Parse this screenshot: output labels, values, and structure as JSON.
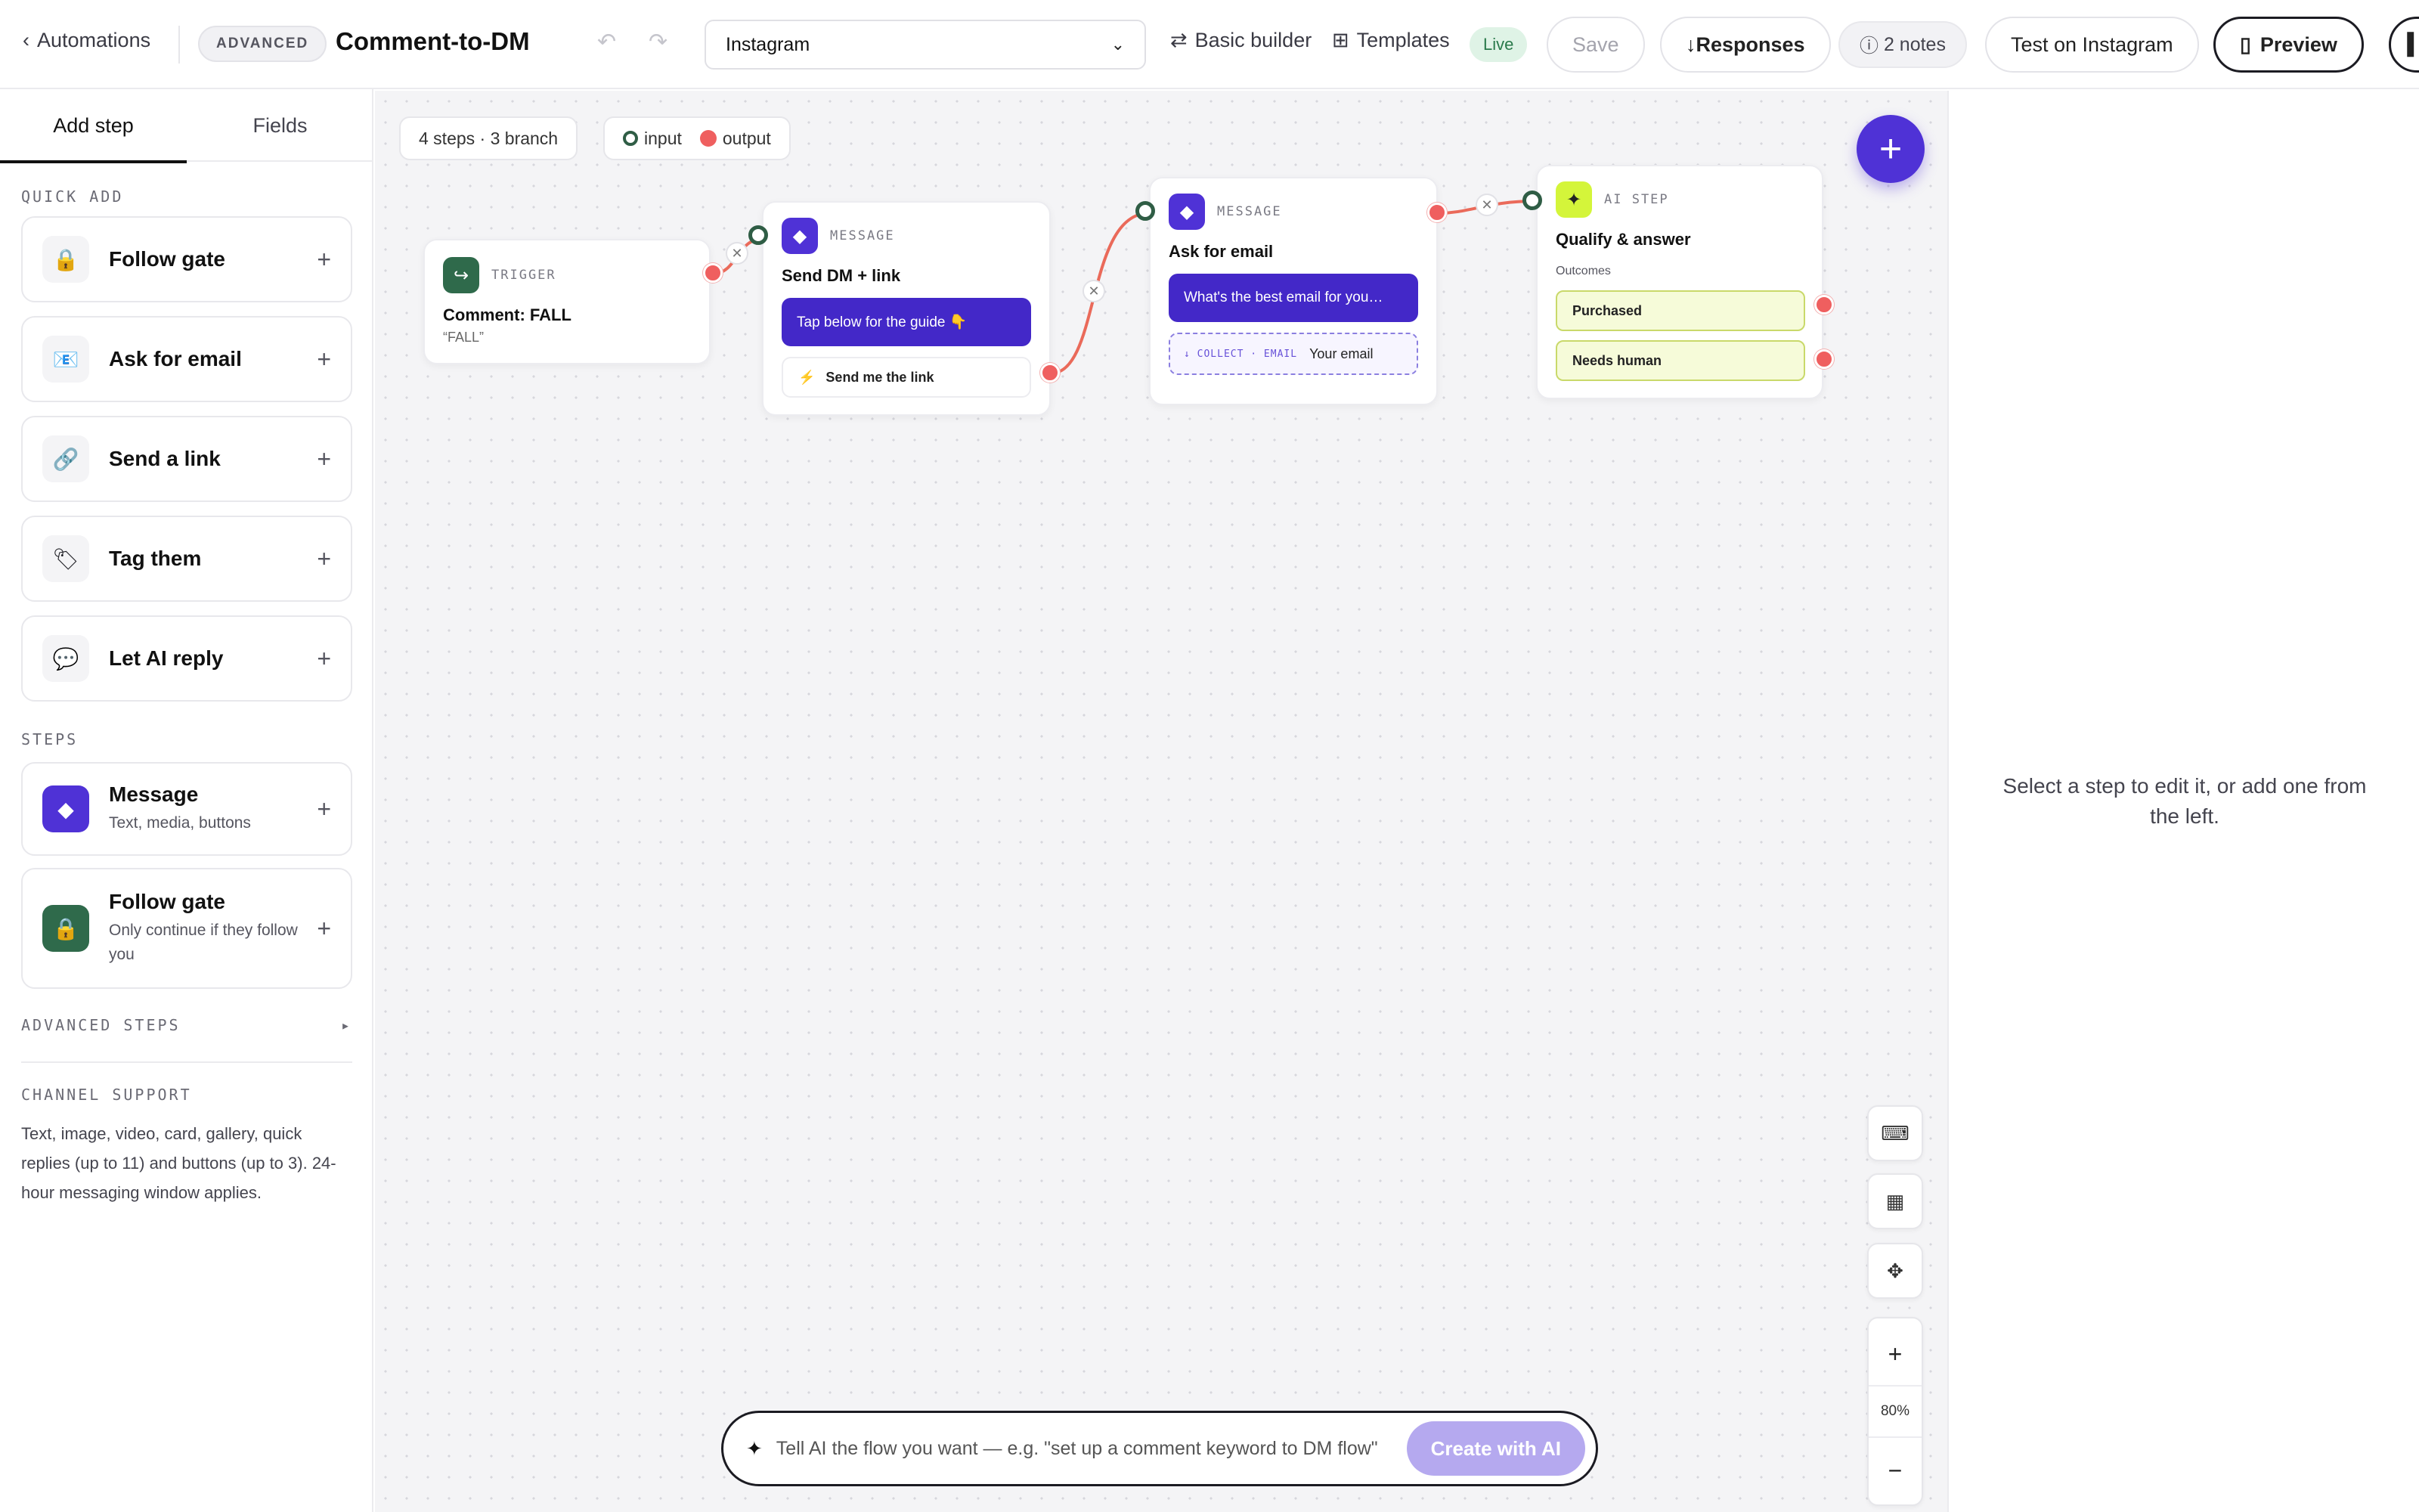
{
  "topbar": {
    "back_label": "Automations",
    "mode_badge": "ADVANCED",
    "title": "Comment-to-DM",
    "channel_select": "Instagram",
    "basic_builder": "Basic builder",
    "templates": "Templates",
    "status": "Live",
    "save": "Save",
    "responses": "Responses",
    "notes": "2 notes",
    "test": "Test on Instagram",
    "preview": "Preview"
  },
  "left": {
    "tabs": [
      "Add step",
      "Fields"
    ],
    "quick_add_label": "QUICK ADD",
    "quick_add": [
      {
        "label": "Follow gate",
        "icon": "lock-icon"
      },
      {
        "label": "Ask for email",
        "icon": "email-icon"
      },
      {
        "label": "Send a link",
        "icon": "link-icon"
      },
      {
        "label": "Tag them",
        "icon": "tag-icon"
      },
      {
        "label": "Let AI reply",
        "icon": "chat-bubble-icon"
      }
    ],
    "steps_label": "STEPS",
    "steps": [
      {
        "label": "Message",
        "sub": "Text, media, buttons"
      },
      {
        "label": "Follow gate",
        "sub": "Only continue if they follow you"
      }
    ],
    "advanced_label": "ADVANCED STEPS",
    "channel_support_label": "CHANNEL SUPPORT",
    "channel_support_text": "Text, image, video, card, gallery, quick replies (up to 11) and buttons (up to 3). 24-hour messaging window applies."
  },
  "canvas": {
    "summary": "4 steps · 3 branch",
    "legend_input": "input",
    "legend_output": "output",
    "nodes": {
      "trigger": {
        "type": "TRIGGER",
        "title": "Comment: FALL",
        "sub": "“FALL”"
      },
      "msg1": {
        "type": "MESSAGE",
        "title": "Send DM + link",
        "bubble": "Tap below for the guide 👇",
        "button": "Send me the link"
      },
      "msg2": {
        "type": "MESSAGE",
        "title": "Ask for email",
        "bubble": "What's the best email for you…",
        "collect_key": "↓ COLLECT · EMAIL",
        "collect_value": "Your email"
      },
      "ai": {
        "type": "AI STEP",
        "title": "Qualify & answer",
        "outcomes_label": "Outcomes",
        "outcomes": [
          "Purchased",
          "Needs human"
        ]
      }
    },
    "zoom": "80%",
    "ai_placeholder": "Tell AI the flow you want — e.g. \"set up a comment keyword to DM flow\"",
    "ai_button": "Create with AI"
  },
  "right": {
    "empty": "Select a step to edit it, or add one from the left."
  },
  "colors": {
    "accent": "#4f32d6",
    "message_bubble": "#4328c8",
    "output_port": "#ef5f5f",
    "input_port": "#2f5d45",
    "outcome_fill": "#f6fbd9"
  }
}
